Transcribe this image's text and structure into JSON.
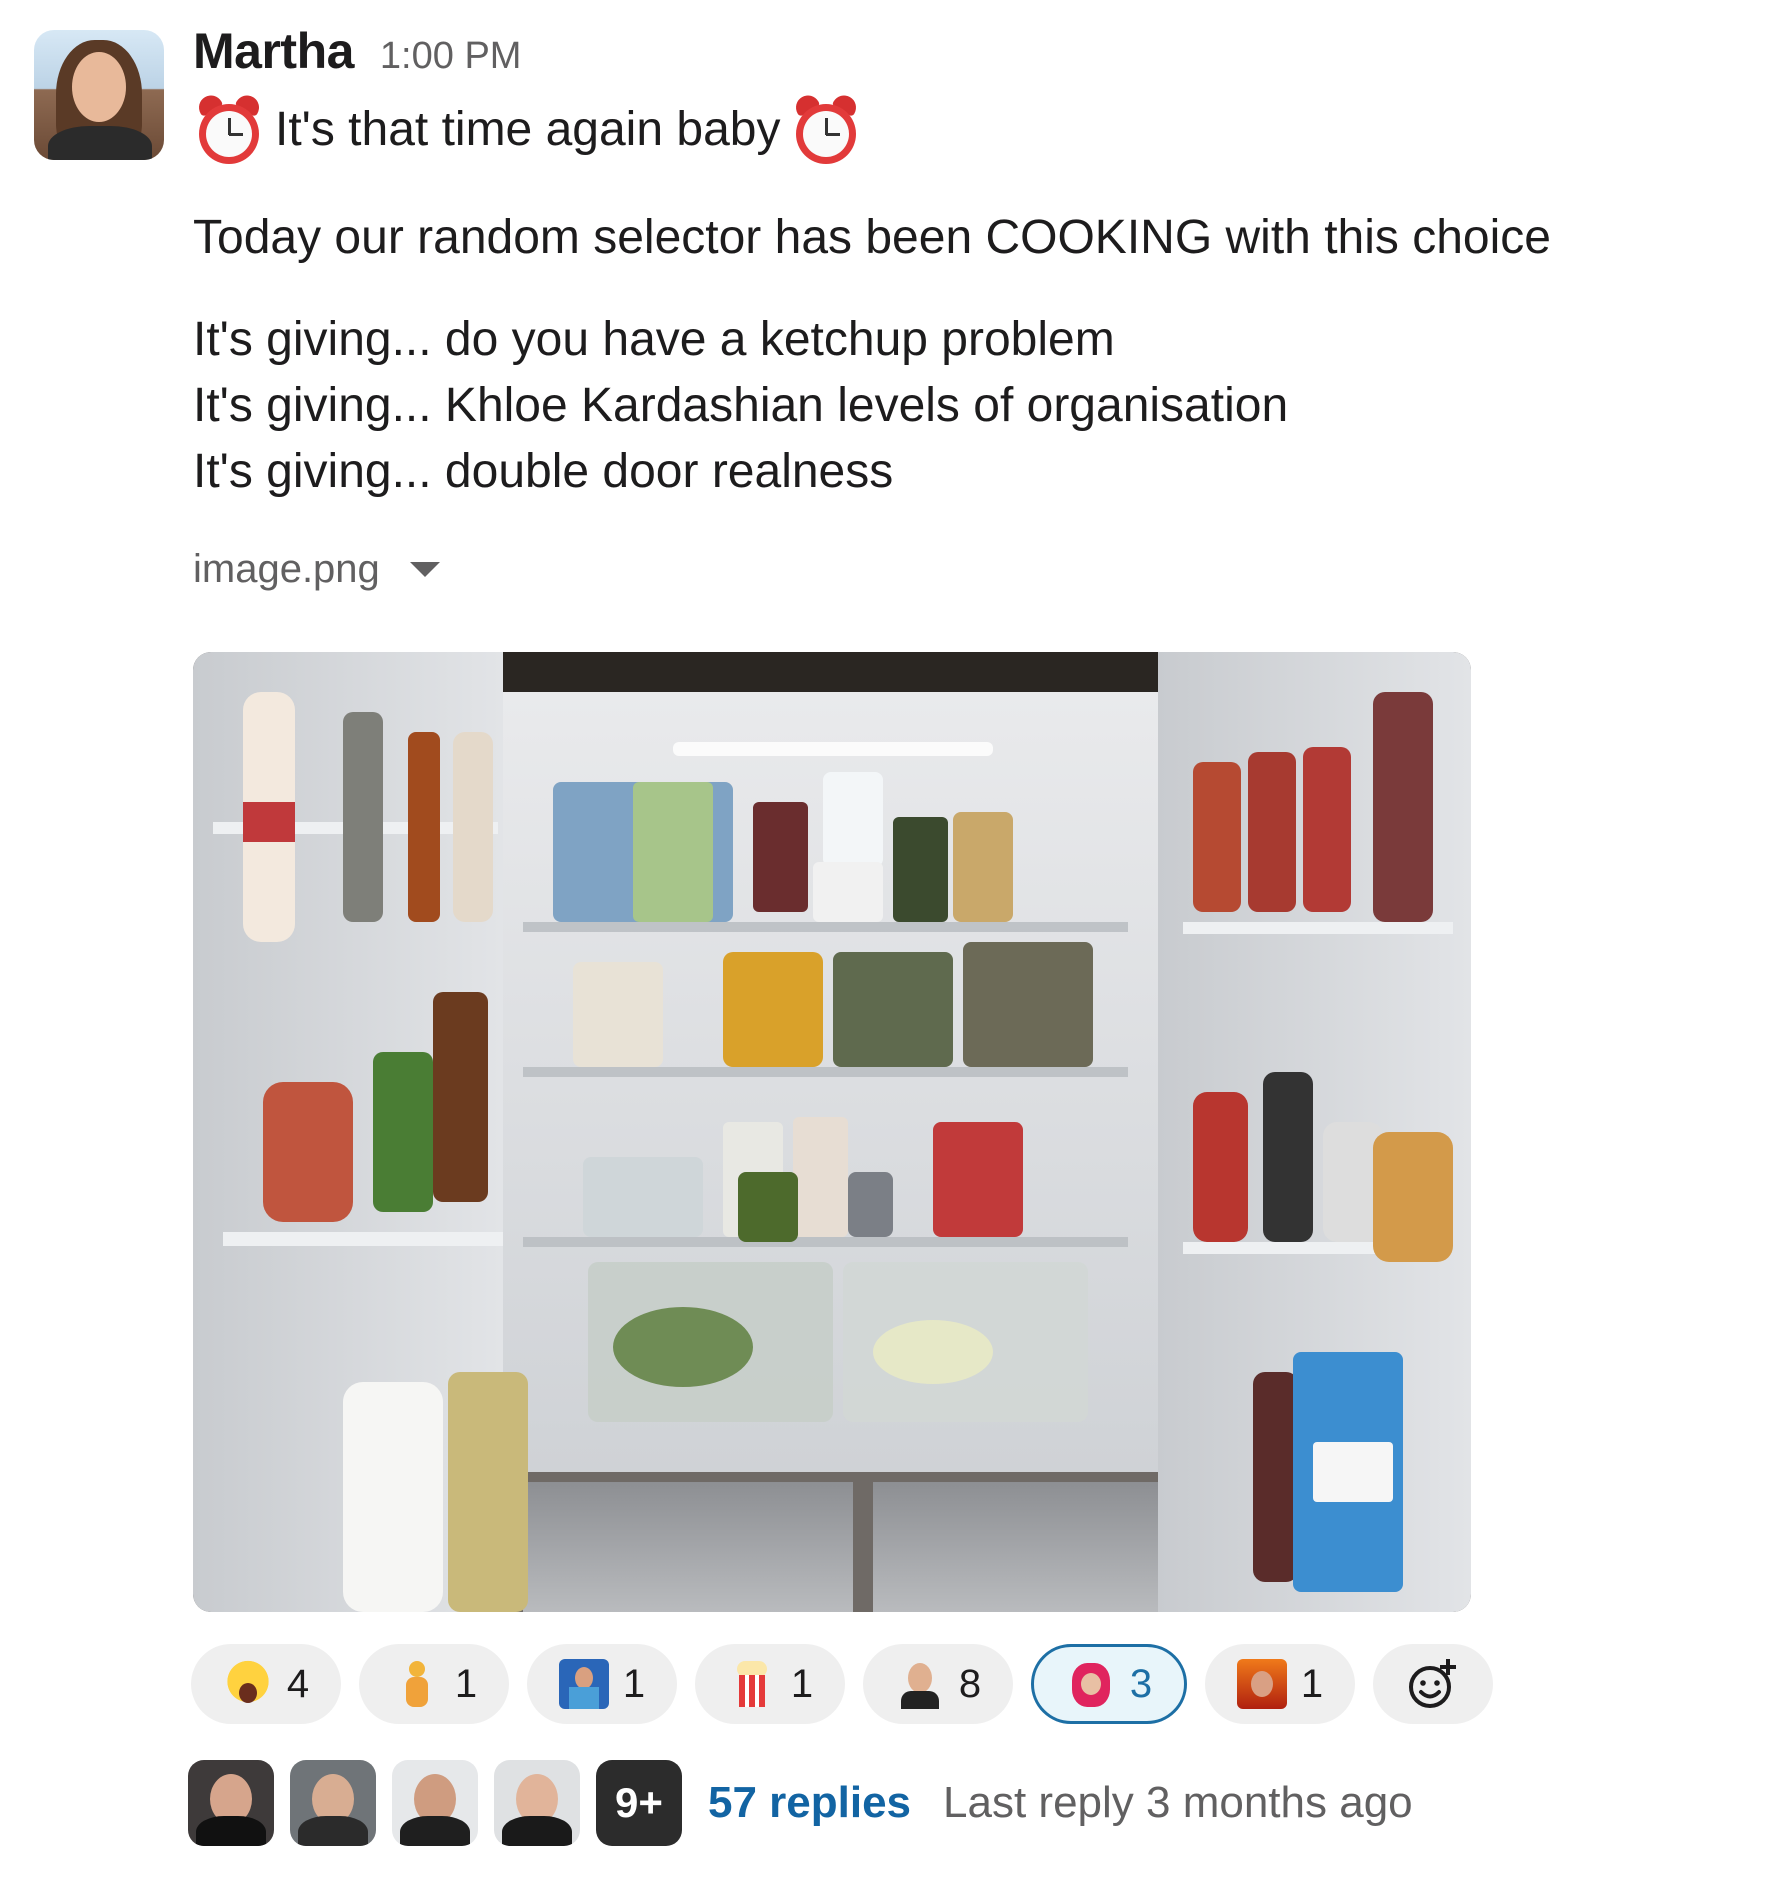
{
  "message": {
    "author": "Martha",
    "time": "1:00 PM",
    "line1": "It's that time again baby",
    "line2": "Today our random selector has been COOKING with this choice",
    "giving": [
      "It's giving... do you have a ketchup problem",
      "It's giving... Khloe Kardashian levels of organisation",
      "It's giving... double door realness"
    ],
    "leading_emoji": "alarm-clock-icon",
    "trailing_emoji": "alarm-clock-icon"
  },
  "attachment": {
    "filename": "image.png"
  },
  "reactions": [
    {
      "emoji": "screaming-face-icon",
      "count": "4"
    },
    {
      "emoji": "custom-figure-icon",
      "count": "1"
    },
    {
      "emoji": "custom-news-anchor-icon",
      "count": "1"
    },
    {
      "emoji": "popcorn-icon",
      "count": "1"
    },
    {
      "emoji": "custom-shocked-man-icon",
      "count": "8"
    },
    {
      "emoji": "custom-bear-hood-icon",
      "count": "3",
      "active": true
    },
    {
      "emoji": "custom-fire-face-icon",
      "count": "1"
    }
  ],
  "thread": {
    "more_count": "9+",
    "replies": "57 replies",
    "last_reply": "Last reply 3 months ago"
  },
  "colors": {
    "link": "#1264a3",
    "active_reaction_border": "#1d6fa5",
    "active_reaction_bg": "#e8f5fa",
    "muted_text": "#616061"
  }
}
